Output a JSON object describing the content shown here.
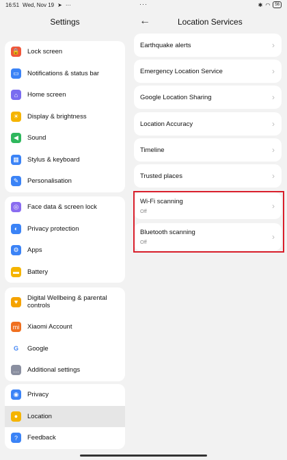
{
  "statusbar": {
    "time": "16:51",
    "date": "Wed, Nov 19",
    "more": "···",
    "center": "···",
    "battery": "56"
  },
  "left": {
    "title": "Settings",
    "groups": [
      [
        {
          "label": "Lock screen",
          "icon": "lock-icon",
          "color": "#f0573a"
        },
        {
          "label": "Notifications & status bar",
          "icon": "notification-icon",
          "color": "#3b83f6"
        },
        {
          "label": "Home screen",
          "icon": "home-icon",
          "color": "#7a6cf0"
        },
        {
          "label": "Display & brightness",
          "icon": "sun-icon",
          "color": "#f5b400"
        },
        {
          "label": "Sound",
          "icon": "sound-icon",
          "color": "#2fb75d"
        },
        {
          "label": "Stylus & keyboard",
          "icon": "keyboard-icon",
          "color": "#3b83f6"
        },
        {
          "label": "Personalisation",
          "icon": "brush-icon",
          "color": "#3b83f6"
        }
      ],
      [
        {
          "label": "Face data & screen lock",
          "icon": "fingerprint-icon",
          "color": "#8a6cf0"
        },
        {
          "label": "Privacy protection",
          "icon": "privacy-icon",
          "color": "#3b83f6"
        },
        {
          "label": "Apps",
          "icon": "gear-icon",
          "color": "#3b83f6"
        },
        {
          "label": "Battery",
          "icon": "battery-icon",
          "color": "#f5b400"
        }
      ],
      [
        {
          "label": "Digital Wellbeing & parental controls",
          "icon": "wellbeing-icon",
          "color": "#f5a300"
        },
        {
          "label": "Xiaomi Account",
          "icon": "mi-icon",
          "color": "#f07020"
        },
        {
          "label": "Google",
          "icon": "google-icon",
          "color": "#ffffff"
        },
        {
          "label": "Additional settings",
          "icon": "more-icon",
          "color": "#8a8fa0"
        }
      ],
      [
        {
          "label": "Privacy",
          "icon": "eye-icon",
          "color": "#3b83f6"
        },
        {
          "label": "Location",
          "icon": "location-icon",
          "color": "#f5b400"
        },
        {
          "label": "Feedback",
          "icon": "feedback-icon",
          "color": "#3b83f6"
        }
      ]
    ]
  },
  "right": {
    "title": "Location Services",
    "items": [
      {
        "label": "Earthquake alerts"
      },
      {
        "label": "Emergency Location Service"
      },
      {
        "label": "Google Location Sharing"
      },
      {
        "label": "Location Accuracy"
      },
      {
        "label": "Timeline"
      },
      {
        "label": "Trusted places"
      },
      {
        "label": "Wi-Fi scanning",
        "sub": "Off"
      },
      {
        "label": "Bluetooth scanning",
        "sub": "Off"
      }
    ]
  },
  "colors": {
    "highlight": "#d91e2a",
    "background": "#f2f2f2"
  }
}
